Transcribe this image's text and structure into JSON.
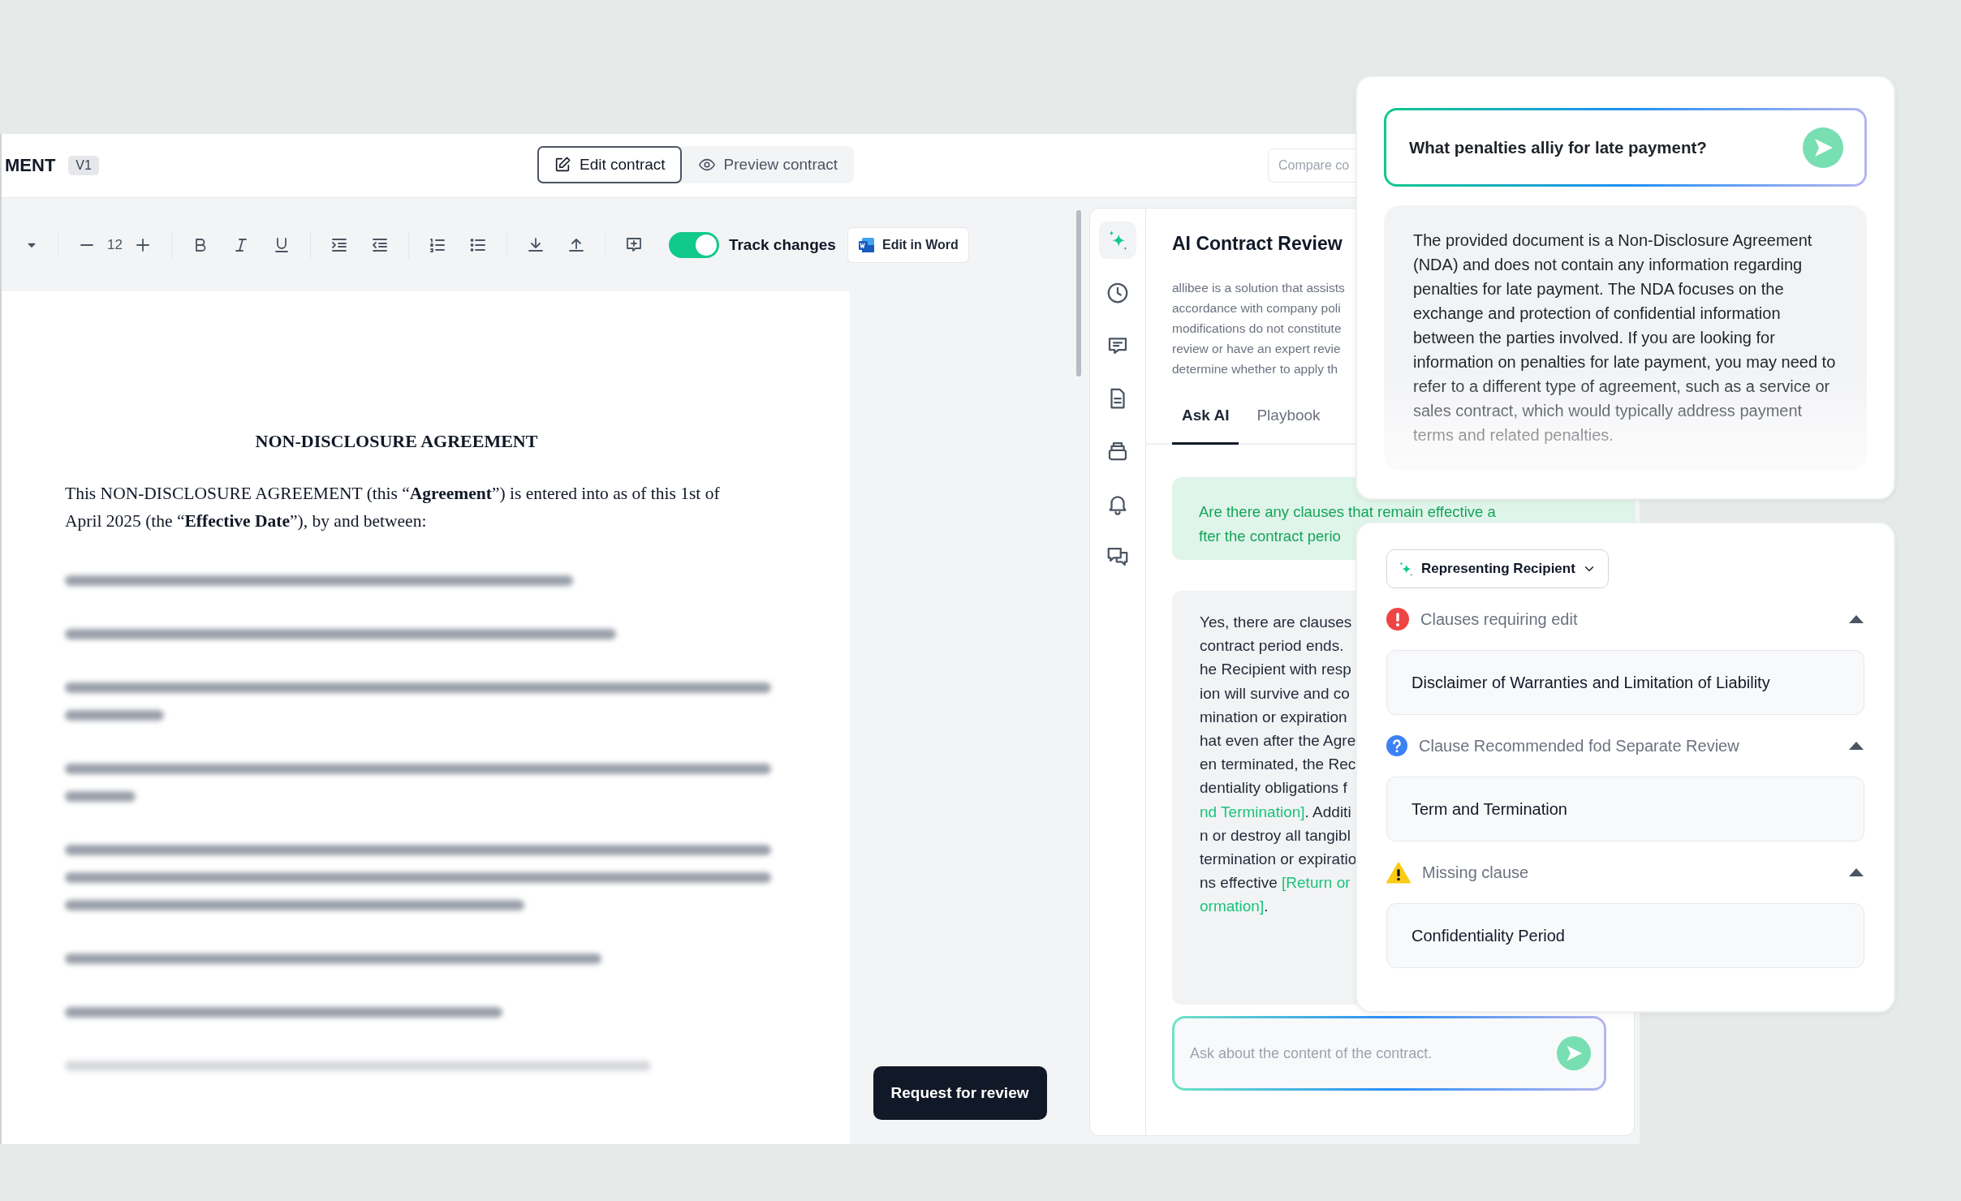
{
  "header": {
    "title": "MENT",
    "version": "V1",
    "view_modes": [
      {
        "label": "Edit contract",
        "selected": true
      },
      {
        "label": "Preview contract",
        "selected": false
      }
    ],
    "compare_button": "Compare co"
  },
  "toolbar": {
    "font_size": "12",
    "track_changes": {
      "label": "Track changes",
      "on": true
    },
    "edit_in_word": "Edit in Word"
  },
  "document": {
    "title": "NON-DISCLOSURE AGREEMENT",
    "intro": "This NON-DISCLOSURE AGREEMENT (this “**Agreement**”) is entered into as of this 1st of April  2025 (the “**Effective Date**”), by and between:"
  },
  "request_button": "Request for review",
  "sidebar_icons": [
    {
      "kind": "sparkle",
      "selected": true
    },
    {
      "kind": "clock",
      "selected": false
    },
    {
      "kind": "message",
      "selected": false
    },
    {
      "kind": "file",
      "selected": false
    },
    {
      "kind": "archive",
      "selected": false
    },
    {
      "kind": "bell",
      "selected": false
    },
    {
      "kind": "chat",
      "selected": false
    }
  ],
  "ai_panel": {
    "title": "AI Contract Review",
    "disclaimer_lines": [
      "allibee is a solution that assists",
      "accordance with company poli",
      "modifications do not constitute",
      "review or have an expert revie",
      "determine whether to apply th"
    ],
    "tabs": [
      {
        "label": "Ask AI",
        "selected": true
      },
      {
        "label": "Playbook",
        "selected": false
      }
    ],
    "question_lines": [
      "Are there any clauses that remain effective a",
      "fter the contract perio"
    ],
    "answer_lines": [
      [
        {
          "kind": "text",
          "text": "Yes, there are clauses"
        }
      ],
      [
        {
          "kind": "text",
          "text": "contract period ends."
        }
      ],
      [
        {
          "kind": "text",
          "text": "he Recipient with resp"
        }
      ],
      [
        {
          "kind": "text",
          "text": "ion will survive and co"
        }
      ],
      [
        {
          "kind": "text",
          "text": "mination or expiration"
        }
      ],
      [
        {
          "kind": "text",
          "text": "hat even after the Agre"
        }
      ],
      [
        {
          "kind": "text",
          "text": "en terminated, the Rec"
        }
      ],
      [
        {
          "kind": "text",
          "text": "dentiality obligations f"
        }
      ],
      [
        {
          "kind": "link",
          "text": "nd Termination]"
        },
        {
          "kind": "text",
          "text": ". Additi"
        }
      ],
      [
        {
          "kind": "text",
          "text": "n or destroy all tangibl"
        }
      ],
      [
        {
          "kind": "text",
          "text": "termination or expiratio"
        }
      ],
      [
        {
          "kind": "text",
          "text": "ns effective "
        },
        {
          "kind": "link",
          "text": "[Return or"
        }
      ],
      [
        {
          "kind": "link",
          "text": "ormation]"
        },
        {
          "kind": "text",
          "text": "."
        }
      ]
    ],
    "input": {
      "placeholder": "Ask about the content of the contract."
    }
  },
  "ask_card": {
    "question": "What penalties alliy for late payment?",
    "answer": "The provided document is a Non-Disclosure Agreement (NDA) and does not contain any information regarding penalties for late payment. The NDA focuses on the exchange and protection of confidential information between the parties involved. If you are looking for information on penalties for late payment, you may need to refer to a different type of agreement, such as a service or sales contract, which would typically address payment terms and related penalties."
  },
  "clauses_card": {
    "perspective": "Representing Recipient",
    "groups": [
      {
        "kind": "edit",
        "title": "Clauses requiring edit",
        "expanded": true,
        "items": [
          "Disclaimer of Warranties and Limitation of Liability"
        ]
      },
      {
        "kind": "review",
        "title": "Clause Recommended fod Separate Review",
        "expanded": true,
        "items": [
          "Term and Termination"
        ]
      },
      {
        "kind": "missing",
        "title": "Missing clause",
        "expanded": true,
        "items": [
          "Confidentiality Period"
        ]
      }
    ]
  }
}
